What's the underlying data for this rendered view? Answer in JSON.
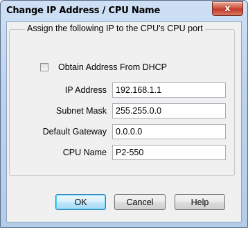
{
  "window": {
    "title": "Change IP Address / CPU Name",
    "close_glyph": "x"
  },
  "group": {
    "legend": "Assign the following IP to the CPU's CPU port"
  },
  "dhcp": {
    "label": "Obtain Address From DHCP",
    "checked": false
  },
  "fields": {
    "ip_label": "IP Address",
    "ip_value": "192.168.1.1",
    "subnet_label": "Subnet Mask",
    "subnet_value": "255.255.0.0",
    "gateway_label": "Default Gateway",
    "gateway_value": "0.0.0.0",
    "cpu_name_label": "CPU Name",
    "cpu_name_value": "P2-550"
  },
  "buttons": {
    "ok": "OK",
    "cancel": "Cancel",
    "help": "Help"
  }
}
